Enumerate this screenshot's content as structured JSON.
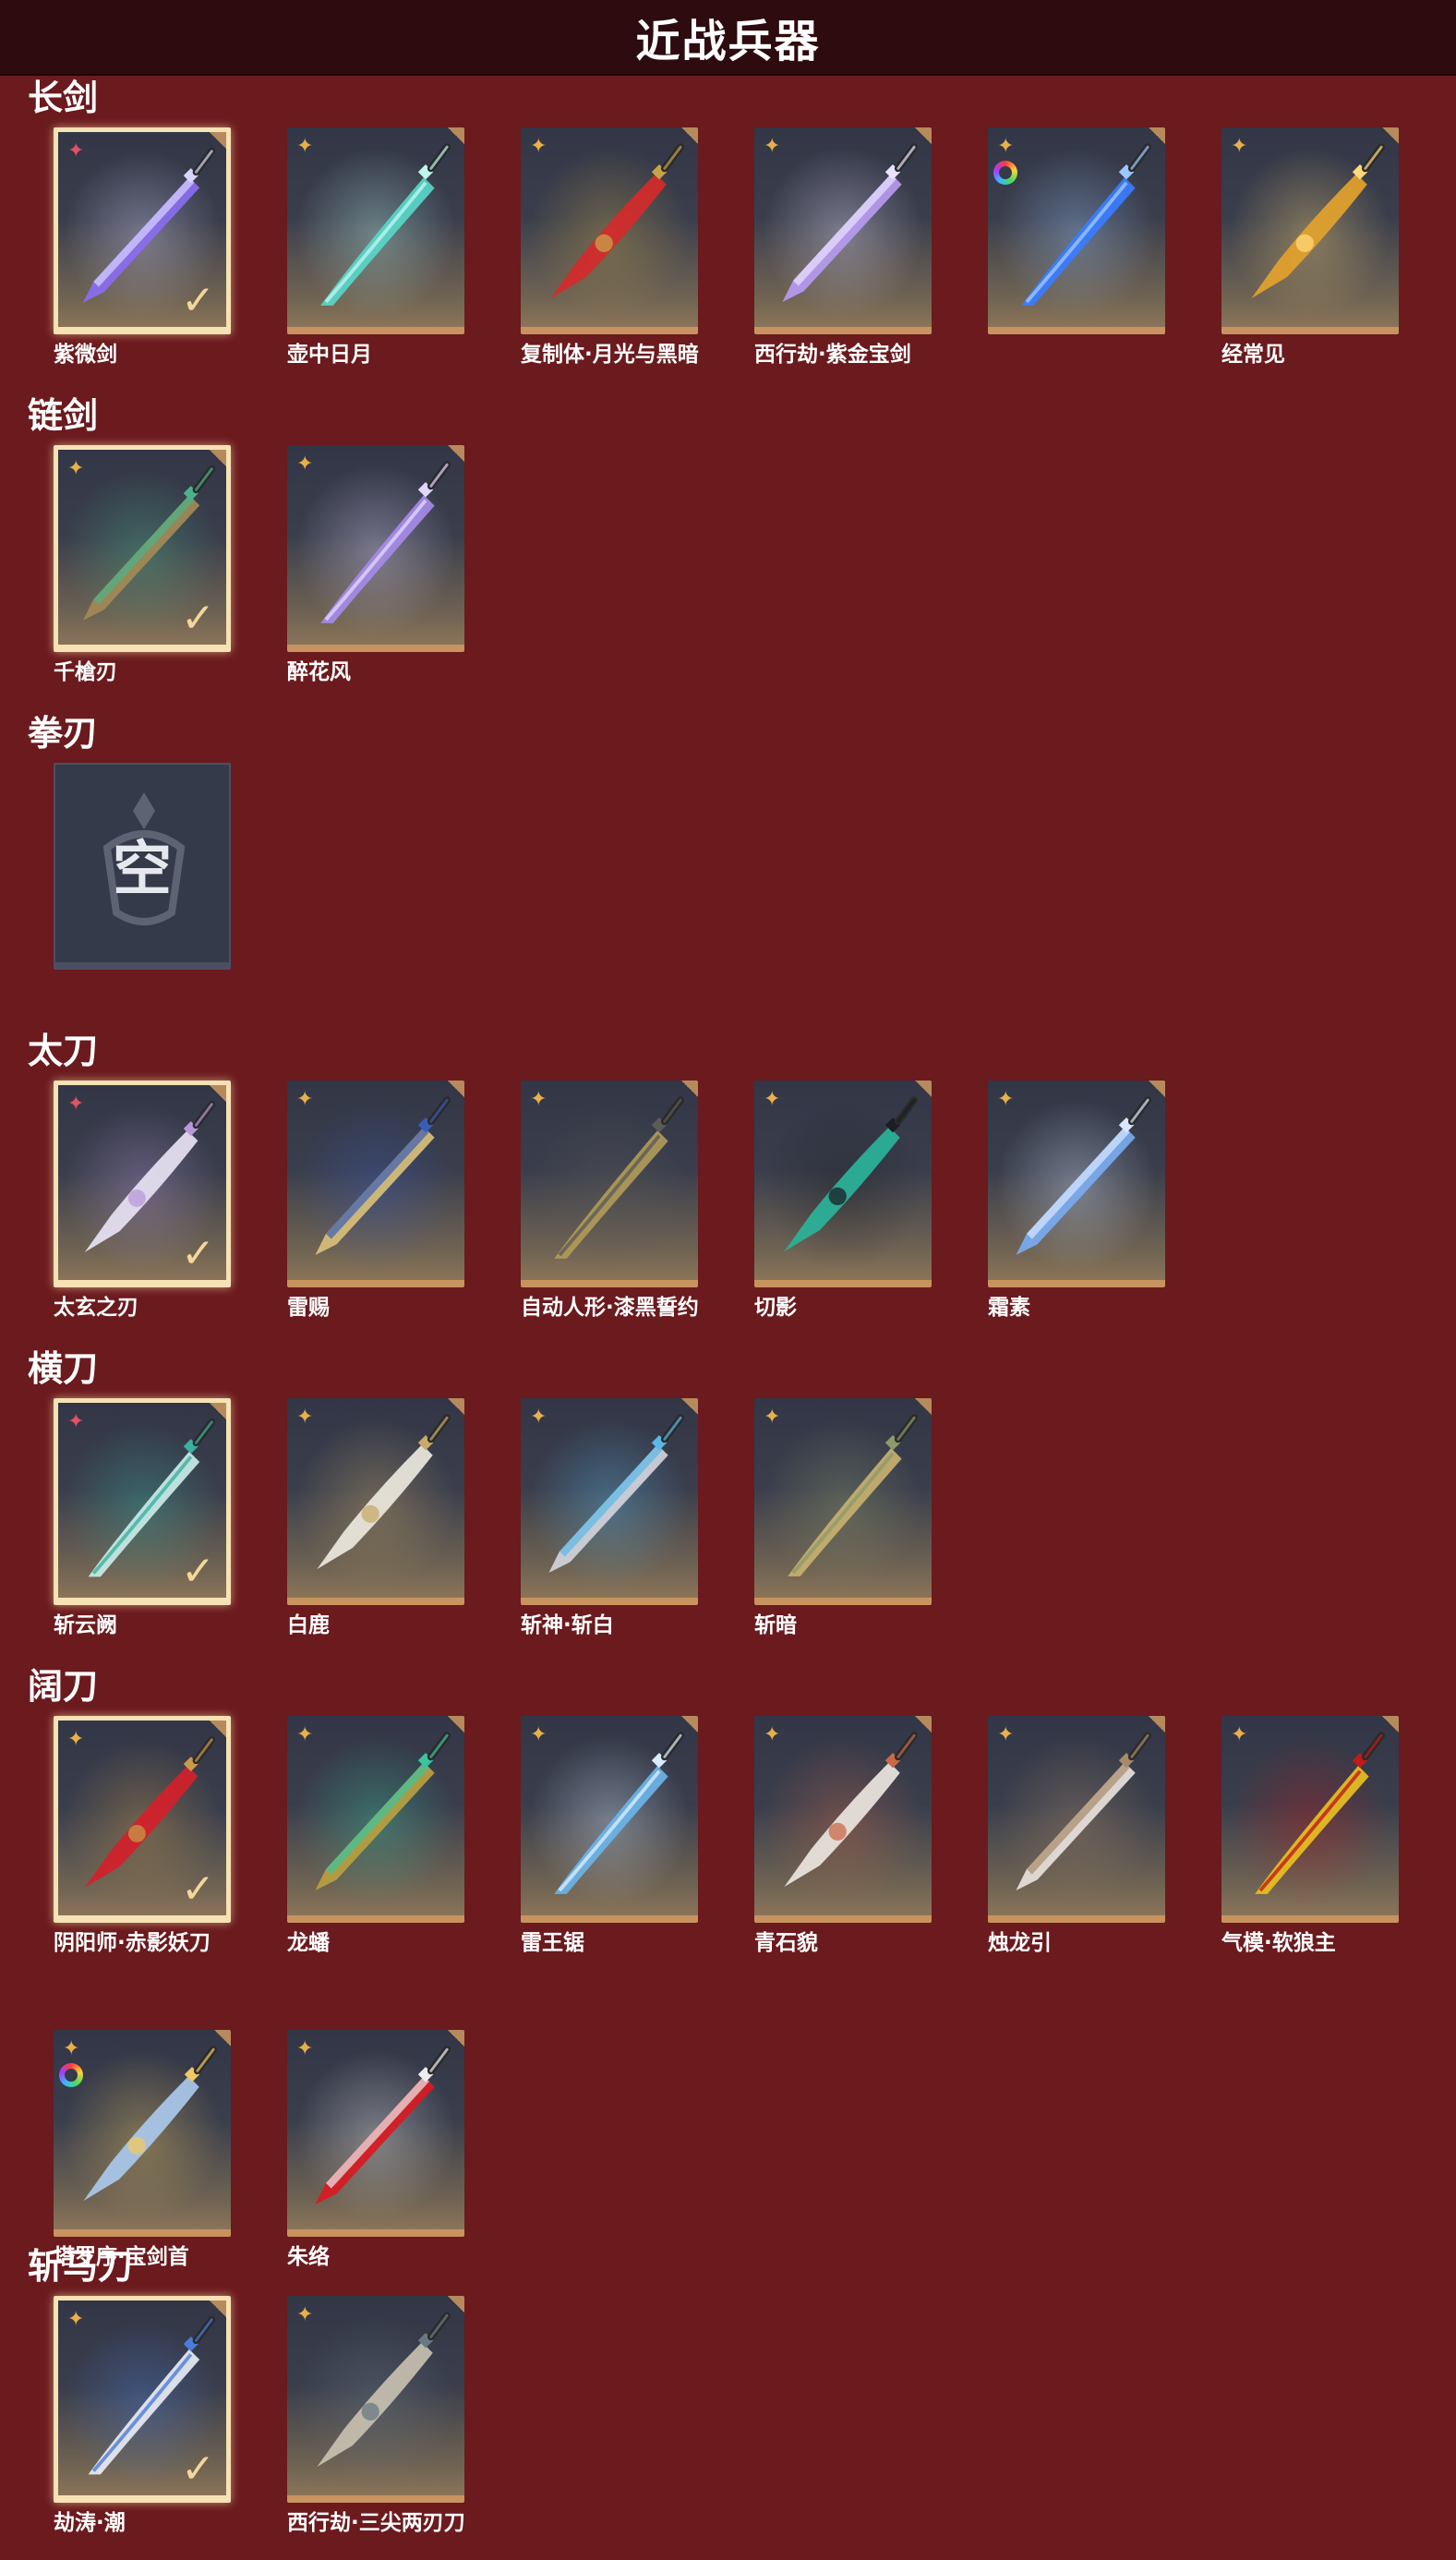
{
  "page": {
    "title": "近战兵器"
  },
  "sections": [
    {
      "title": "长剑",
      "items": [
        {
          "name": "紫微剑",
          "selected": true,
          "rarity": "red",
          "blade": "#8a6cf0",
          "accent": "#d9d4ff"
        },
        {
          "name": "壶中日月",
          "selected": false,
          "rarity": "gold",
          "blade": "#58d6c8",
          "accent": "#bdf5ef"
        },
        {
          "name": "复制体·月光与黑暗",
          "selected": false,
          "rarity": "gold",
          "blade": "#d42a2a",
          "accent": "#c7a44a"
        },
        {
          "name": "西行劫·紫金宝剑",
          "selected": false,
          "rarity": "gold",
          "blade": "#b79af0",
          "accent": "#e9e2ff"
        },
        {
          "name": "",
          "selected": false,
          "rarity": "gold",
          "rainbow": true,
          "blade": "#3b7cff",
          "accent": "#9cc7ff"
        },
        {
          "name": "经常见",
          "selected": false,
          "rarity": "gold",
          "blade": "#e3a22c",
          "accent": "#ffd97a"
        }
      ]
    },
    {
      "title": "链剑",
      "items": [
        {
          "name": "千槍刃",
          "selected": true,
          "rarity": "gold",
          "blade": "#a38a55",
          "accent": "#4bb38a"
        },
        {
          "name": "醉花风",
          "selected": false,
          "rarity": "gold",
          "blade": "#a58ae8",
          "accent": "#e0d6ff"
        }
      ]
    },
    {
      "title": "拳刃",
      "items": [
        {
          "name": "",
          "empty": true,
          "empty_text": "空"
        }
      ]
    },
    {
      "title": "太刀",
      "items": [
        {
          "name": "太玄之刃",
          "selected": true,
          "rarity": "red",
          "blade": "#e8e2f4",
          "accent": "#b798d8"
        },
        {
          "name": "雷赐",
          "selected": false,
          "rarity": "gold",
          "blade": "#d8c07a",
          "accent": "#3a5cb8"
        },
        {
          "name": "自动人形·漆黑誓约",
          "selected": false,
          "rarity": "gold",
          "blade": "#b09a58",
          "accent": "#5c5b58"
        },
        {
          "name": "切影",
          "selected": false,
          "rarity": "gold",
          "blade": "#2ab39a",
          "accent": "#1b1e24"
        },
        {
          "name": "霜素",
          "selected": false,
          "rarity": "gold",
          "blade": "#7aaaf0",
          "accent": "#d9e8ff"
        }
      ]
    },
    {
      "title": "横刀",
      "items": [
        {
          "name": "斩云阙",
          "selected": true,
          "rarity": "red",
          "blade": "#c9ece8",
          "accent": "#3ab0a0"
        },
        {
          "name": "白鹿",
          "selected": false,
          "rarity": "gold",
          "blade": "#ece8de",
          "accent": "#c8aa6a"
        },
        {
          "name": "斩神·斩白",
          "selected": false,
          "rarity": "gold",
          "blade": "#d2d4dc",
          "accent": "#5ab8e8"
        },
        {
          "name": "斩暗",
          "selected": false,
          "rarity": "gold",
          "blade": "#c8b070",
          "accent": "#8d9a6a"
        }
      ]
    },
    {
      "title": "阔刀",
      "items": [
        {
          "name": "阴阳师·赤影妖刀",
          "selected": true,
          "rarity": "gold",
          "blade": "#d4202a",
          "accent": "#c89a4a"
        },
        {
          "name": "龙蟠",
          "selected": false,
          "rarity": "gold",
          "blade": "#b8a040",
          "accent": "#3ac4a0"
        },
        {
          "name": "雷王锯",
          "selected": false,
          "rarity": "gold",
          "blade": "#6ab4e8",
          "accent": "#d8ecff"
        },
        {
          "name": "青石貌",
          "selected": false,
          "rarity": "gold",
          "blade": "#ece6e0",
          "accent": "#c86a4a"
        },
        {
          "name": "烛龙引",
          "selected": false,
          "rarity": "gold",
          "blade": "#e8e2dc",
          "accent": "#a88a6a"
        },
        {
          "name": "气模·软狼主",
          "selected": false,
          "rarity": "gold",
          "blade": "#e8c020",
          "accent": "#c01a1a"
        }
      ]
    },
    {
      "title": "",
      "items": [
        {
          "name": "塔罗序·宝剑首",
          "selected": false,
          "rarity": "gold",
          "rainbow": true,
          "blade": "#aac8ec",
          "accent": "#f0c860"
        },
        {
          "name": "朱络",
          "selected": false,
          "rarity": "gold",
          "blade": "#d81a22",
          "accent": "#ececec"
        }
      ]
    },
    {
      "title": "斩马刀",
      "items": [
        {
          "name": "劫涛·潮",
          "selected": true,
          "rarity": "gold",
          "blade": "#e8ecf4",
          "accent": "#4a7cd8"
        },
        {
          "name": "西行劫·三尖两刃刀",
          "selected": false,
          "rarity": "gold",
          "blade": "#c8c0b0",
          "accent": "#6a7a84"
        }
      ]
    }
  ]
}
